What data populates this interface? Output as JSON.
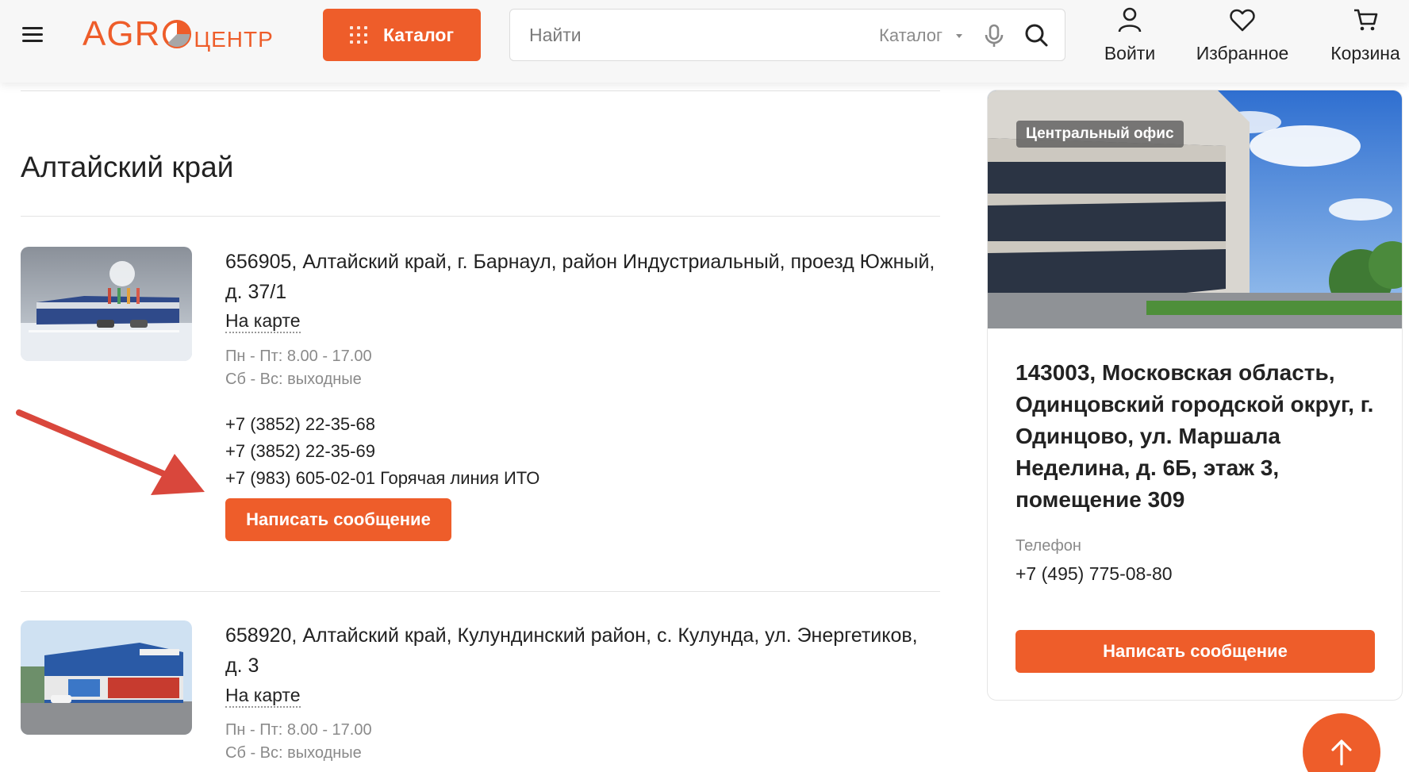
{
  "header": {
    "logo": {
      "left": "AGR",
      "right": "ЦЕНТР"
    },
    "catalog_button": "Каталог",
    "search": {
      "placeholder": "Найти",
      "scope": "Каталог"
    },
    "actions": {
      "login": "Войти",
      "favorites": "Избранное",
      "cart": "Корзина"
    },
    "icons": [
      "menu-icon",
      "grid-icon",
      "microphone-icon",
      "search-icon",
      "user-icon",
      "heart-icon",
      "cart-icon"
    ]
  },
  "main": {
    "region_title": "Алтайский край",
    "branches": [
      {
        "address": "656905, Алтайский край, г. Барнаул, район Индустриальный, проезд Южный, д. 37/1",
        "map_link": "На карте",
        "hours_weekdays": "Пн - Пт: 8.00 - 17.00",
        "hours_weekend": "Сб - Вс: выходные",
        "phones": [
          "+7 (3852) 22-35-68",
          "+7 (3852) 22-35-69",
          "+7 (983) 605-02-01 Горячая линия ИТО"
        ],
        "button": "Написать сообщение"
      },
      {
        "address": "658920, Алтайский край, Кулундинский район, с. Кулунда, ул. Энергетиков, д. 3",
        "map_link": "На карте",
        "hours_weekdays": "Пн - Пт: 8.00 - 17.00",
        "hours_weekend": "Сб - Вс: выходные"
      }
    ]
  },
  "office": {
    "badge": "Центральный офис",
    "address": "143003,  Московская область, Одинцовский городской округ, г. Одинцово, ул. Маршала Неделина, д. 6Б, этаж 3, помещение 309",
    "phone_label": "Телефон",
    "phone": "+7 (495) 775-08-80",
    "button": "Написать сообщение"
  },
  "colors": {
    "accent": "#ee5d2a",
    "annotation_arrow": "#d9473c",
    "muted_text": "#8a8a8a"
  }
}
